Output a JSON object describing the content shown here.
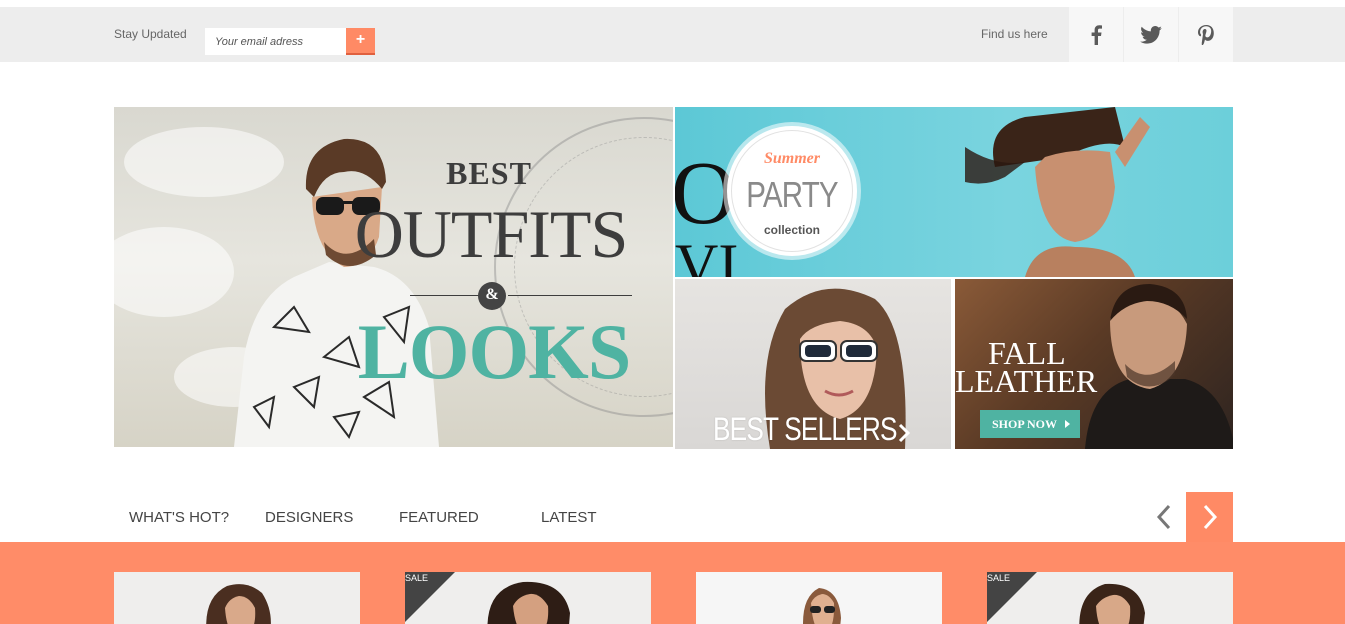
{
  "topbar": {
    "stay_label": "Stay Updated",
    "email_placeholder": "Your email adress",
    "subscribe_label": "+",
    "find_label": "Find us here",
    "social": [
      "facebook-icon",
      "twitter-icon",
      "pinterest-icon"
    ]
  },
  "hero": {
    "main": {
      "line1": "BEST",
      "line2": "OUTFITS",
      "amp": "&",
      "line3": "LOOKS"
    },
    "summer": {
      "script": "Summer",
      "title": "PARTY",
      "sub": "collection"
    },
    "best_sellers": {
      "label": "BEST SELLERS"
    },
    "leather": {
      "line1": "FALL",
      "line2": "LEATHER",
      "button": "SHOP NOW"
    }
  },
  "tabs": [
    "WHAT'S HOT?",
    "DESIGNERS",
    "FEATURED",
    "LATEST"
  ],
  "products": [
    {
      "sale": false
    },
    {
      "sale": true,
      "badge": "SALE"
    },
    {
      "sale": false
    },
    {
      "sale": true,
      "badge": "SALE"
    }
  ],
  "colors": {
    "accent": "#ff8a65",
    "teal": "#4fb3a2",
    "dark": "#3d3d3d",
    "topbar_bg": "#ededed"
  }
}
